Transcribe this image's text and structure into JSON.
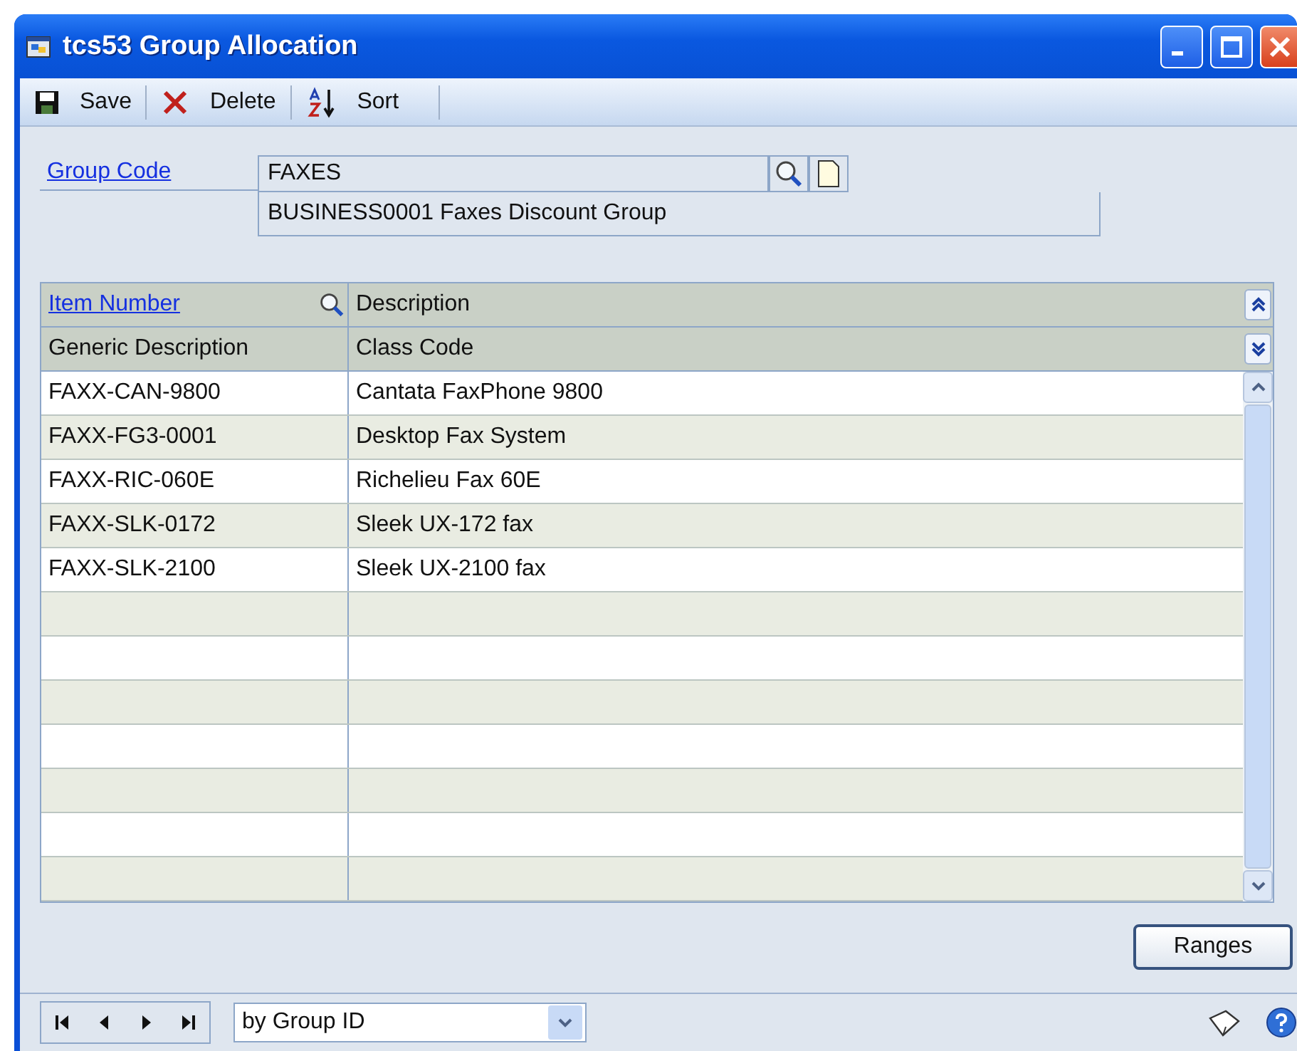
{
  "window": {
    "title": "tcs53 Group Allocation"
  },
  "toolbar": [
    {
      "kind": "save",
      "label": "Save"
    },
    {
      "kind": "delete",
      "label": "Delete"
    },
    {
      "kind": "sort",
      "label": "Sort"
    }
  ],
  "group_code": {
    "label": "Group Code",
    "value": "FAXES",
    "description": "BUSINESS0001 Faxes Discount Group"
  },
  "grid": {
    "header_row_1": [
      "Item Number",
      "Description"
    ],
    "header_row_2": [
      "Generic Description",
      "Class Code"
    ],
    "rows": [
      {
        "item_number": "FAXX-CAN-9800",
        "description": "Cantata FaxPhone 9800"
      },
      {
        "item_number": "FAXX-FG3-0001",
        "description": "Desktop Fax System"
      },
      {
        "item_number": "FAXX-RIC-060E",
        "description": "Richelieu Fax 60E"
      },
      {
        "item_number": "FAXX-SLK-0172",
        "description": "Sleek UX-172 fax"
      },
      {
        "item_number": "FAXX-SLK-2100",
        "description": "Sleek UX-2100 fax"
      }
    ]
  },
  "ranges_button": "Ranges",
  "footer": {
    "sort_by": "by Group ID"
  }
}
